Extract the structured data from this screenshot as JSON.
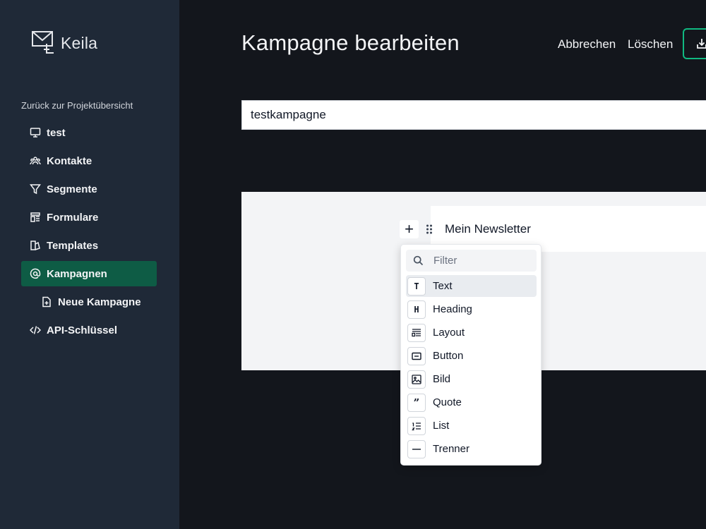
{
  "app": {
    "name": "Keila"
  },
  "sidebar": {
    "back_label": "Zurück zur Projektübersicht",
    "items": [
      {
        "label": "test",
        "icon": "monitor-icon"
      },
      {
        "label": "Kontakte",
        "icon": "users-icon"
      },
      {
        "label": "Segmente",
        "icon": "filter-icon"
      },
      {
        "label": "Formulare",
        "icon": "form-icon"
      },
      {
        "label": "Templates",
        "icon": "templates-icon"
      },
      {
        "label": "Kampagnen",
        "icon": "at-icon",
        "active": true
      },
      {
        "label": "Neue Kampagne",
        "icon": "file-plus-icon"
      },
      {
        "label": "API-Schlüssel",
        "icon": "code-icon"
      }
    ]
  },
  "header": {
    "title": "Kampagne bearbeiten",
    "cancel_label": "Abbrechen",
    "delete_label": "Löschen",
    "save_icon": "save-icon"
  },
  "form": {
    "subject_value": "testkampagne"
  },
  "editor": {
    "block_text": "Mein Newsletter",
    "filter_placeholder": "Filter",
    "menu": [
      {
        "label": "Text",
        "icon": "text-icon"
      },
      {
        "label": "Heading",
        "icon": "heading-icon"
      },
      {
        "label": "Layout",
        "icon": "layout-icon"
      },
      {
        "label": "Button",
        "icon": "button-icon"
      },
      {
        "label": "Bild",
        "icon": "image-icon"
      },
      {
        "label": "Quote",
        "icon": "quote-icon"
      },
      {
        "label": "List",
        "icon": "list-icon"
      },
      {
        "label": "Trenner",
        "icon": "divider-icon"
      }
    ]
  },
  "colors": {
    "sidebar_bg": "#1f2937",
    "page_bg": "#13161c",
    "accent": "#0e5c45",
    "accent_border": "#10b981"
  }
}
